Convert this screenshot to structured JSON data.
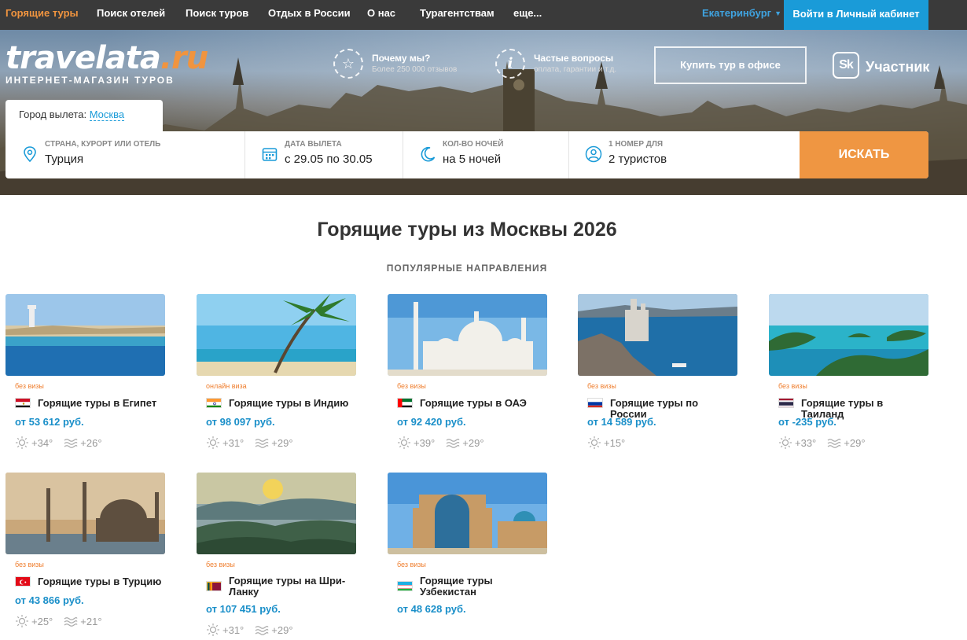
{
  "nav": {
    "items": [
      "Горящие туры",
      "Поиск отелей",
      "Поиск туров",
      "Отдых в России",
      "О нас",
      "Турагентствам",
      "еще..."
    ],
    "city": "Екатеринбург",
    "login": "Войти в Личный кабинет"
  },
  "logo": {
    "main": "travelata",
    "suffix": ".ru",
    "tagline": "ИНТЕРНЕТ-МАГАЗИН ТУРОВ"
  },
  "promo": [
    {
      "icon": "star-icon",
      "title": "Почему мы?",
      "subtitle": "Более 250 000 отзывов"
    },
    {
      "icon": "info-icon",
      "title": "Частые вопросы",
      "subtitle": "оплата, гарантии и т.д."
    }
  ],
  "buy_office": "Купить тур в офисе",
  "skolkovo": {
    "badge": "Sk",
    "label": "Участник"
  },
  "departure": {
    "label": "Город вылета:",
    "value": "Москва"
  },
  "search": {
    "fields": [
      {
        "label": "СТРАНА, КУРОРТ ИЛИ ОТЕЛЬ",
        "value": "Турция",
        "icon": "location-pin-icon"
      },
      {
        "label": "ДАТА ВЫЛЕТА",
        "value": "с 29.05 по 30.05",
        "icon": "calendar-icon"
      },
      {
        "label": "КОЛ-ВО НОЧЕЙ",
        "value": "на 5 ночей",
        "icon": "moon-icon"
      },
      {
        "label": "1 НОМЕР ДЛЯ",
        "value": "2 туристов",
        "icon": "person-icon"
      }
    ],
    "button": "ИСКАТЬ"
  },
  "heading": "Горящие туры из Москвы 2026",
  "subheading": "ПОПУЛЯРНЫЕ НАПРАВЛЕНИЯ",
  "cards": [
    {
      "visa": "без визы",
      "title": "Горящие туры в Египет",
      "price": "от 53 612 руб.",
      "air": "+34°",
      "water": "+26°",
      "flag": "egypt"
    },
    {
      "visa": "онлайн виза",
      "title": "Горящие туры в Индию",
      "price": "от 98 097 руб.",
      "air": "+31°",
      "water": "+29°",
      "flag": "india"
    },
    {
      "visa": "без визы",
      "title": "Горящие туры в ОАЭ",
      "price": "от 92 420 руб.",
      "air": "+39°",
      "water": "+29°",
      "flag": "uae"
    },
    {
      "visa": "без визы",
      "title": "Горящие туры по России",
      "price": "от 14 589 руб.",
      "air": "+15°",
      "water": "",
      "flag": "russia"
    },
    {
      "visa": "без визы",
      "title": "Горящие туры в Таиланд",
      "price": "от -235 руб.",
      "air": "+33°",
      "water": "+29°",
      "flag": "thailand"
    },
    {
      "visa": "без визы",
      "title": "Горящие туры в Турцию",
      "price": "от 43 866 руб.",
      "air": "+25°",
      "water": "+21°",
      "flag": "turkey"
    },
    {
      "visa": "без визы",
      "title": "Горящие туры на Шри-Ланку",
      "price": "от 107 451 руб.",
      "air": "+31°",
      "water": "+29°",
      "flag": "srilanka"
    },
    {
      "visa": "без визы",
      "title": "Горящие туры Узбекистан",
      "price": "от 48 628 руб.",
      "air": "",
      "water": "",
      "flag": "uzbekistan"
    }
  ]
}
